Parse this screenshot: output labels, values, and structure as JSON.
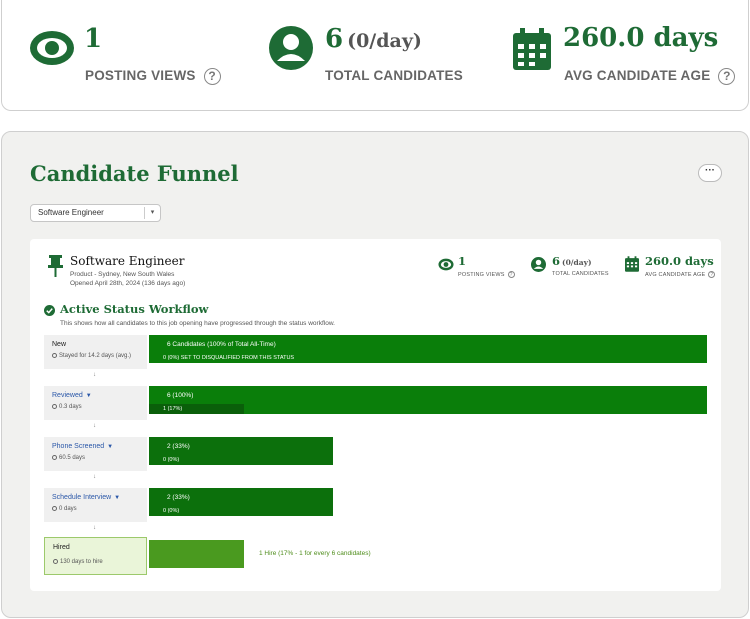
{
  "stats": {
    "views": {
      "value": "1",
      "label": "POSTING VIEWS",
      "help": "?",
      "icon": "eye-icon"
    },
    "candidates": {
      "value": "6",
      "sub": "(0/day)",
      "label": "TOTAL CANDIDATES",
      "icon": "person-icon"
    },
    "age": {
      "value": "260.0 days",
      "label": "AVG CANDIDATE AGE",
      "help": "?",
      "icon": "calendar-icon"
    }
  },
  "funnel": {
    "title": "Candidate Funnel",
    "more_label": "···",
    "job_select": {
      "value": "Software Engineer",
      "caret": "▾"
    },
    "job": {
      "title": "Software Engineer",
      "location": "Product - Sydney, New South Wales",
      "opened": "Opened April 28th, 2024 (136 days ago)",
      "views": {
        "value": "1",
        "label": "POSTING VIEWS",
        "help": "?"
      },
      "candidates": {
        "value": "6",
        "sub": "(0/day)",
        "label": "TOTAL CANDIDATES"
      },
      "age": {
        "value": "260.0 days",
        "label": "AVG CANDIDATE AGE",
        "help": "?"
      }
    },
    "workflow": {
      "title": "Active Status Workflow",
      "description": "This shows how all candidates to this job opening have progressed through the status workflow."
    },
    "arrow_glyph": "↓",
    "dropdown_glyph": "▼",
    "stages": [
      {
        "name": "New",
        "time": "Stayed for 14.2 days (avg.)",
        "count": "6 Candidates (100% of Total All-Time)",
        "disqualified": "0 (0%) SET TO DISQUALIFIED FROM THIS STATUS",
        "bar_fraction": 1.0,
        "sub_fraction": 0.0
      },
      {
        "name": "Reviewed",
        "time": "0.3 days",
        "count": "6 (100%)",
        "disqualified": "1 (17%)",
        "bar_fraction": 1.0,
        "sub_fraction": 0.17
      },
      {
        "name": "Phone Screened",
        "time": "60.5 days",
        "count": "2 (33%)",
        "disqualified": "0 (0%)",
        "bar_fraction": 0.33,
        "sub_fraction": 0.0
      },
      {
        "name": "Schedule Interview",
        "time": "0 days",
        "count": "2 (33%)",
        "disqualified": "0 (0%)",
        "bar_fraction": 0.33,
        "sub_fraction": 0.0
      },
      {
        "name": "Hired",
        "time": "130 days to hire",
        "summary": "1 Hire (17% - 1 for every 6 candidates)",
        "bar_fraction": 0.17
      }
    ],
    "colors": {
      "brand": "#1e6b35",
      "bar": "#0a7e0a",
      "hire_bar": "#4a9a1f",
      "link": "#2a57a8"
    }
  }
}
